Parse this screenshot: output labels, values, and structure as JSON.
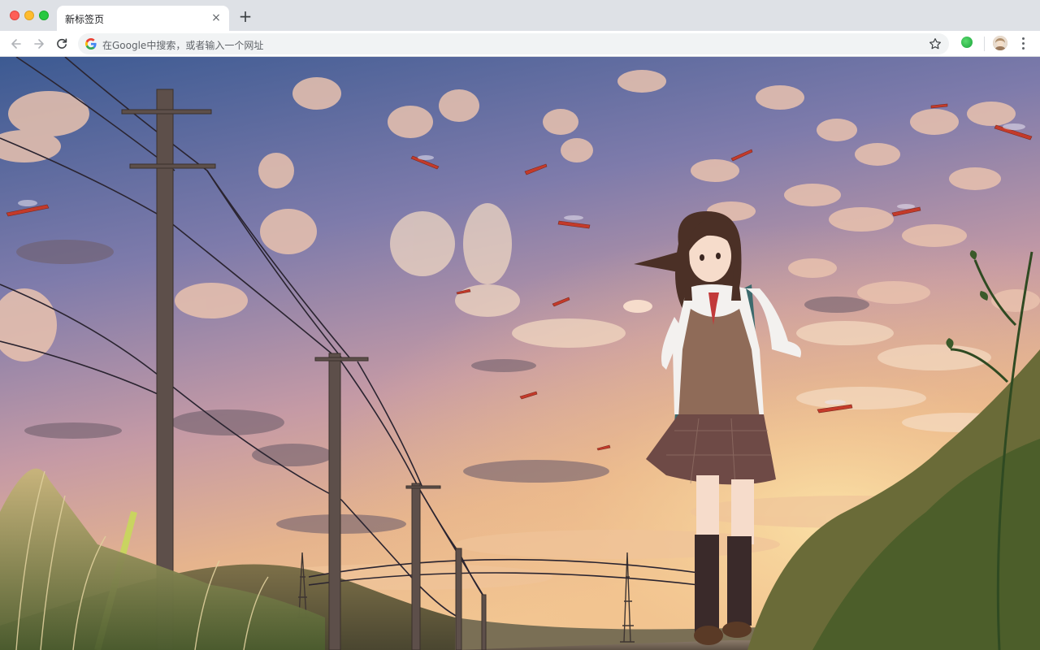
{
  "tab": {
    "title": "新标签页",
    "close_glyph": "×"
  },
  "new_tab_glyph": "+",
  "omnibox": {
    "placeholder": "在Google中搜索，或者输入一个网址"
  },
  "icons": {
    "back": "arrow-left-icon",
    "forward": "arrow-right-icon",
    "reload": "reload-icon",
    "search_engine": "google-g-icon",
    "bookmark": "star-icon",
    "extension": "green-extension-icon",
    "profile": "avatar",
    "menu": "three-dots-vertical-icon"
  },
  "colors": {
    "tabstrip_bg": "#dee1e6",
    "toolbar_bg": "#ffffff",
    "omnibox_bg": "#f1f3f4",
    "sky_top": "#3e5d94",
    "sky_bottom": "#e9b78a"
  }
}
